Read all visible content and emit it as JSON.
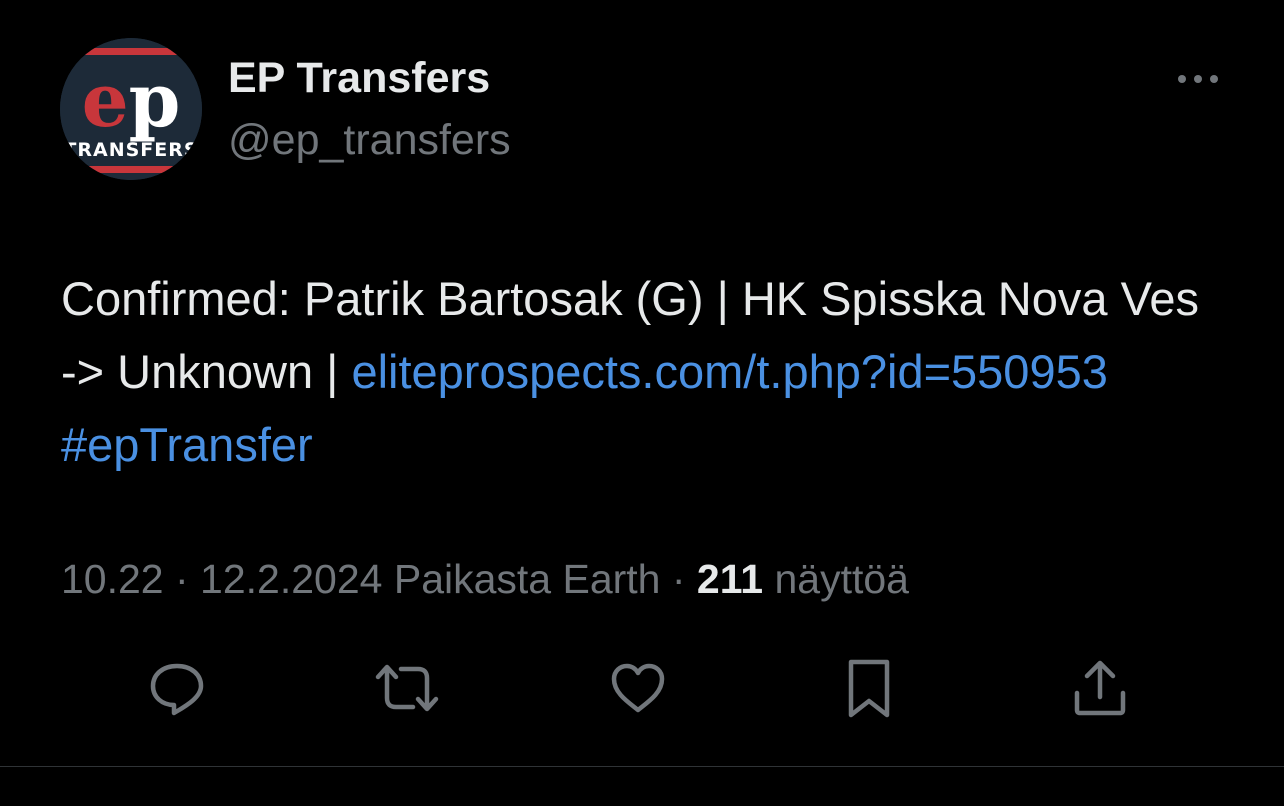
{
  "author": {
    "display_name": "EP Transfers",
    "handle": "@ep_transfers",
    "avatar_logo_text": "ep",
    "avatar_logo_subtext": "TRANSFERS"
  },
  "tweet": {
    "text_plain": "Confirmed: Patrik Bartosak (G) | HK Spisska Nova Ves -> Unknown | ",
    "link_text": "eliteprospects.com/t.php?id=550953",
    "hashtag": "#epTransfer"
  },
  "meta": {
    "time": "10.22",
    "separator_1": " · ",
    "date": "12.2.2024",
    "source": " Paikasta Earth",
    "separator_2": " · ",
    "views_count": "211",
    "views_label": " näyttöä"
  },
  "icons": {
    "more": "more-horizontal-icon",
    "reply": "reply-icon",
    "retweet": "retweet-icon",
    "like": "heart-icon",
    "bookmark": "bookmark-icon",
    "share": "share-icon"
  },
  "colors": {
    "background": "#000000",
    "text_primary": "#e7e9ea",
    "text_secondary": "#71767b",
    "link": "#4a90e2",
    "logo_red": "#c8363b",
    "divider": "#2f3336"
  }
}
